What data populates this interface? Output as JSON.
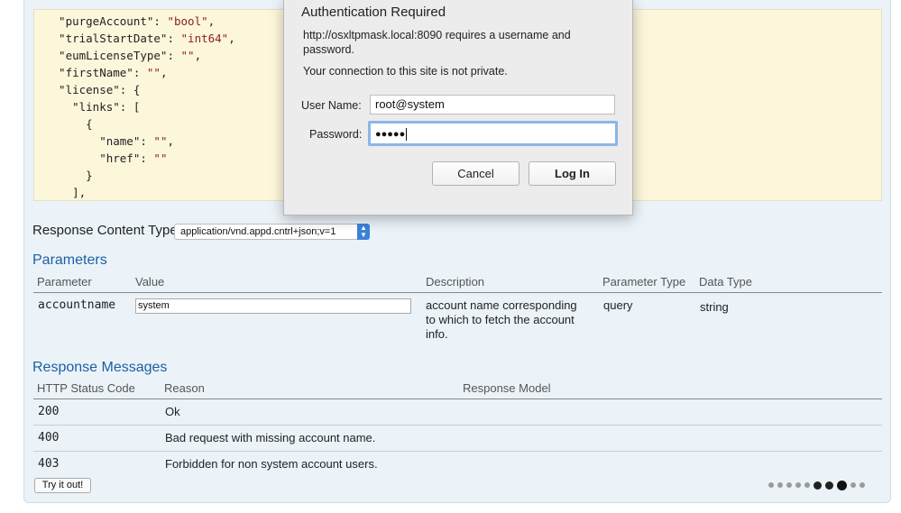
{
  "code_block": {
    "lines": [
      {
        "indent": "  ",
        "key": "\"purgeAccount\": ",
        "value": "\"bool\"",
        "tail": ","
      },
      {
        "indent": "  ",
        "key": "\"trialStartDate\": ",
        "value": "\"int64\"",
        "tail": ","
      },
      {
        "indent": "  ",
        "key": "\"eumLicenseType\": ",
        "value": "\"\"",
        "tail": ","
      },
      {
        "indent": "  ",
        "key": "\"firstName\": ",
        "value": "\"\"",
        "tail": ","
      },
      {
        "indent": "  ",
        "key": "\"license\": {",
        "value": "",
        "tail": ""
      },
      {
        "indent": "    ",
        "key": "\"links\": [",
        "value": "",
        "tail": ""
      },
      {
        "indent": "      ",
        "key": "{",
        "value": "",
        "tail": ""
      },
      {
        "indent": "        ",
        "key": "\"name\": ",
        "value": "\"\"",
        "tail": ","
      },
      {
        "indent": "        ",
        "key": "\"href\": ",
        "value": "\"\"",
        "tail": ""
      },
      {
        "indent": "      ",
        "key": "}",
        "value": "",
        "tail": ""
      },
      {
        "indent": "    ",
        "key": "],",
        "value": "",
        "tail": ""
      }
    ]
  },
  "response_content_type": {
    "label": "Response Content Type",
    "selected": "application/vnd.appd.cntrl+json;v=1"
  },
  "parameters": {
    "heading": "Parameters",
    "columns": [
      "Parameter",
      "Value",
      "Description",
      "Parameter Type",
      "Data Type"
    ],
    "row": {
      "name": "accountname",
      "value": "system",
      "description": "account name corresponding to which to fetch the account info.",
      "param_type": "query",
      "data_type": "string"
    }
  },
  "response_messages": {
    "heading": "Response Messages",
    "columns": [
      "HTTP Status Code",
      "Reason",
      "Response Model"
    ],
    "rows": [
      {
        "code": "200",
        "reason": "Ok"
      },
      {
        "code": "400",
        "reason": "Bad request with missing account name."
      },
      {
        "code": "403",
        "reason": "Forbidden for non system account users."
      }
    ]
  },
  "try_button": "Try it out!",
  "pager": {
    "count": 10,
    "active_index": 7
  },
  "auth_dialog": {
    "title": "Authentication Required",
    "message": "http://osxltpmask.local:8090 requires a username and password.",
    "privacy_note": "Your connection to this site is not private.",
    "username_label": "User Name:",
    "username_value": "root@system",
    "password_label": "Password:",
    "password_mask": "●●●●●",
    "cancel_label": "Cancel",
    "login_label": "Log In"
  },
  "colors": {
    "heading_blue": "#1d5fa3",
    "panel_bg": "#ebf3f9",
    "code_bg": "#fcf6db",
    "string_red": "#8b1f1f"
  }
}
